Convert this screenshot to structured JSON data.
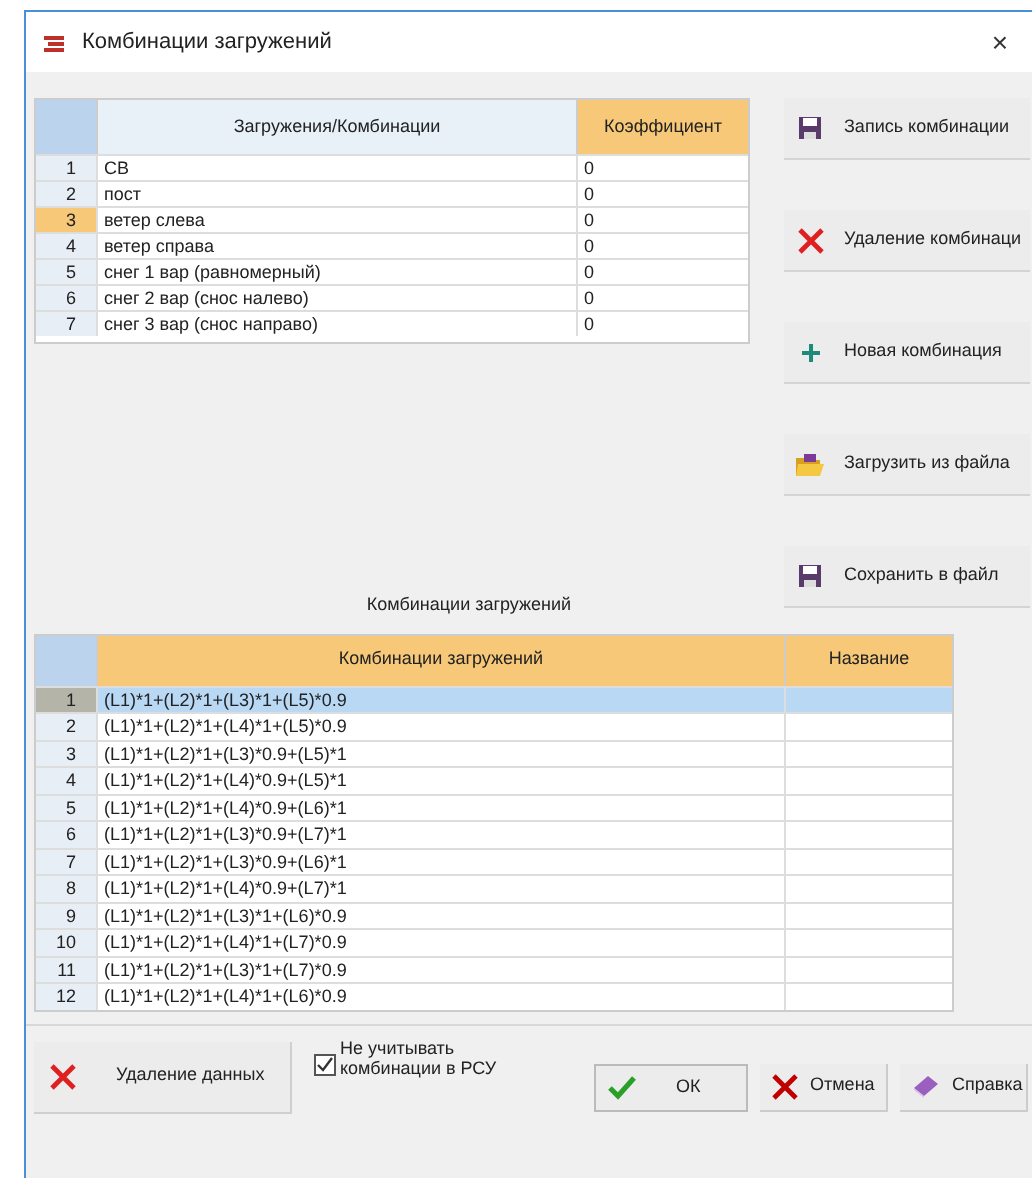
{
  "window": {
    "title": "Комбинации загружений",
    "close": "×"
  },
  "loads_table": {
    "columns": [
      "Загружения/Комбинации",
      "Коэффициент"
    ],
    "rows": [
      {
        "num": "1",
        "name": "СВ",
        "coef": "0",
        "selected": false
      },
      {
        "num": "2",
        "name": "пост",
        "coef": "0",
        "selected": false
      },
      {
        "num": "3",
        "name": "ветер слева",
        "coef": "0",
        "selected": true
      },
      {
        "num": "4",
        "name": "ветер справа",
        "coef": "0",
        "selected": false
      },
      {
        "num": "5",
        "name": "снег 1 вар (равномерный)",
        "coef": "0",
        "selected": false
      },
      {
        "num": "6",
        "name": "снег 2 вар (снос налево)",
        "coef": "0",
        "selected": false
      },
      {
        "num": "7",
        "name": "снег 3 вар (снос направо)",
        "coef": "0",
        "selected": false
      }
    ]
  },
  "side_buttons": [
    {
      "label": "Запись комбинации",
      "kind": "save"
    },
    {
      "label": "Удаление комбинаци",
      "kind": "delete"
    },
    {
      "label": "Новая комбинация",
      "kind": "add"
    },
    {
      "label": "Загрузить из файла",
      "kind": "open"
    },
    {
      "label": "Сохранить в файл",
      "kind": "save"
    }
  ],
  "combos_title": "Комбинации загружений",
  "combos_table": {
    "columns": [
      "Комбинации загружений",
      "Название"
    ],
    "rows": [
      {
        "num": "1",
        "formula": "(L1)*1+(L2)*1+(L3)*1+(L5)*0.9",
        "selected": true
      },
      {
        "num": "2",
        "formula": "(L1)*1+(L2)*1+(L4)*1+(L5)*0.9",
        "selected": false
      },
      {
        "num": "3",
        "formula": "(L1)*1+(L2)*1+(L3)*0.9+(L5)*1",
        "selected": false
      },
      {
        "num": "4",
        "formula": "(L1)*1+(L2)*1+(L4)*0.9+(L5)*1",
        "selected": false
      },
      {
        "num": "5",
        "formula": "(L1)*1+(L2)*1+(L4)*0.9+(L6)*1",
        "selected": false
      },
      {
        "num": "6",
        "formula": "(L1)*1+(L2)*1+(L3)*0.9+(L7)*1",
        "selected": false
      },
      {
        "num": "7",
        "formula": "(L1)*1+(L2)*1+(L3)*0.9+(L6)*1",
        "selected": false
      },
      {
        "num": "8",
        "formula": "(L1)*1+(L2)*1+(L4)*0.9+(L7)*1",
        "selected": false
      },
      {
        "num": "9",
        "formula": "(L1)*1+(L2)*1+(L3)*1+(L6)*0.9",
        "selected": false
      },
      {
        "num": "10",
        "formula": "(L1)*1+(L2)*1+(L4)*1+(L7)*0.9",
        "selected": false
      },
      {
        "num": "11",
        "formula": "(L1)*1+(L2)*1+(L3)*1+(L7)*0.9",
        "selected": false
      },
      {
        "num": "12",
        "formula": "(L1)*1+(L2)*1+(L4)*1+(L6)*0.9",
        "selected": false
      }
    ]
  },
  "delete_data_button": {
    "label": "Удаление данных"
  },
  "exclude_checkbox": {
    "label": "Не учитывать комбинации в РСУ",
    "checked": true
  },
  "footer_buttons": [
    {
      "label": "ОК",
      "kind": "ok"
    },
    {
      "label": "Отмена",
      "kind": "cancel"
    },
    {
      "label": "Справка",
      "kind": "help"
    }
  ]
}
